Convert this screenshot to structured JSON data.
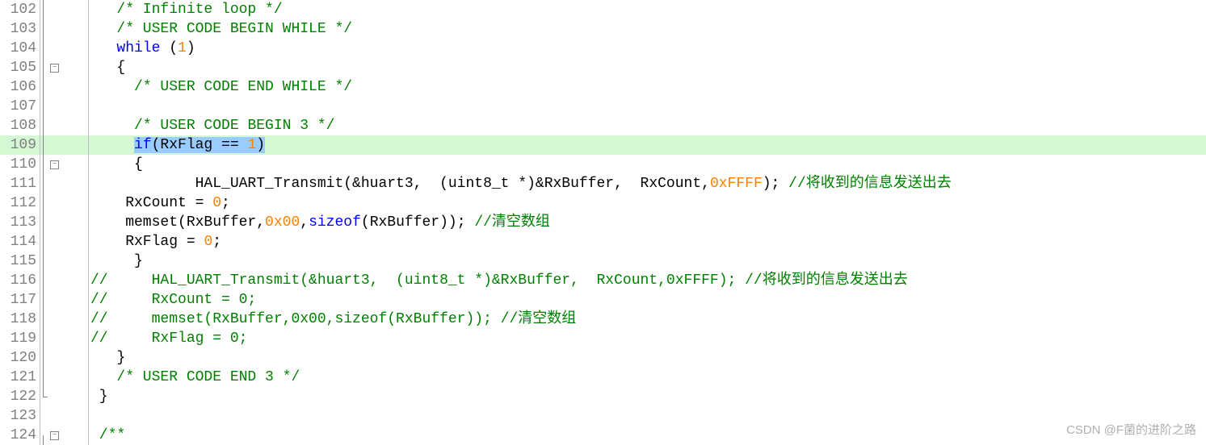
{
  "watermark": "CSDN @F菌的进阶之路",
  "lines": [
    {
      "n": 102,
      "fold": "line",
      "hl": false,
      "tokens": [
        [
          "plain",
          "   "
        ],
        [
          "comment",
          "/* Infinite loop */"
        ]
      ]
    },
    {
      "n": 103,
      "fold": "line",
      "hl": false,
      "tokens": [
        [
          "plain",
          "   "
        ],
        [
          "comment",
          "/* USER CODE BEGIN WHILE */"
        ]
      ]
    },
    {
      "n": 104,
      "fold": "line",
      "hl": false,
      "tokens": [
        [
          "plain",
          "   "
        ],
        [
          "keyword",
          "while"
        ],
        [
          "plain",
          " ("
        ],
        [
          "number",
          "1"
        ],
        [
          "plain",
          ")"
        ]
      ]
    },
    {
      "n": 105,
      "fold": "line-box",
      "hl": false,
      "tokens": [
        [
          "plain",
          "   {"
        ]
      ]
    },
    {
      "n": 106,
      "fold": "line",
      "hl": false,
      "tokens": [
        [
          "plain",
          "     "
        ],
        [
          "comment",
          "/* USER CODE END WHILE */"
        ]
      ]
    },
    {
      "n": 107,
      "fold": "line",
      "hl": false,
      "tokens": []
    },
    {
      "n": 108,
      "fold": "line",
      "hl": false,
      "tokens": [
        [
          "plain",
          "     "
        ],
        [
          "comment",
          "/* USER CODE BEGIN 3 */"
        ]
      ]
    },
    {
      "n": 109,
      "fold": "line",
      "hl": true,
      "tokens": [
        [
          "plain",
          "     "
        ],
        [
          "sel-keyword",
          "if"
        ],
        [
          "sel-plain",
          "(RxFlag == "
        ],
        [
          "sel-number",
          "1"
        ],
        [
          "sel-plain",
          ")"
        ]
      ]
    },
    {
      "n": 110,
      "fold": "line-box",
      "hl": false,
      "tokens": [
        [
          "plain",
          "     {"
        ]
      ]
    },
    {
      "n": 111,
      "fold": "line",
      "hl": false,
      "tokens": [
        [
          "plain",
          "            HAL_UART_Transmit(&huart3,  (uint8_t *)&RxBuffer,  RxCount,"
        ],
        [
          "number",
          "0xFFFF"
        ],
        [
          "plain",
          "); "
        ],
        [
          "comment",
          "//将收到的信息发送出去"
        ]
      ]
    },
    {
      "n": 112,
      "fold": "line",
      "hl": false,
      "tokens": [
        [
          "plain",
          "    RxCount = "
        ],
        [
          "number",
          "0"
        ],
        [
          "plain",
          ";"
        ]
      ]
    },
    {
      "n": 113,
      "fold": "line",
      "hl": false,
      "tokens": [
        [
          "plain",
          "    memset(RxBuffer,"
        ],
        [
          "number",
          "0x00"
        ],
        [
          "plain",
          ","
        ],
        [
          "keyword",
          "sizeof"
        ],
        [
          "plain",
          "(RxBuffer)); "
        ],
        [
          "comment",
          "//清空数组"
        ]
      ]
    },
    {
      "n": 114,
      "fold": "line",
      "hl": false,
      "tokens": [
        [
          "plain",
          "    RxFlag = "
        ],
        [
          "number",
          "0"
        ],
        [
          "plain",
          ";"
        ]
      ]
    },
    {
      "n": 115,
      "fold": "line",
      "hl": false,
      "tokens": [
        [
          "plain",
          "     }"
        ]
      ]
    },
    {
      "n": 116,
      "fold": "line",
      "hl": false,
      "tokens": [
        [
          "comment",
          "//     HAL_UART_Transmit(&huart3,  (uint8_t *)&RxBuffer,  RxCount,0xFFFF); //将收到的信息发送出去"
        ]
      ]
    },
    {
      "n": 117,
      "fold": "line",
      "hl": false,
      "tokens": [
        [
          "comment",
          "//     RxCount = 0;"
        ]
      ]
    },
    {
      "n": 118,
      "fold": "line",
      "hl": false,
      "tokens": [
        [
          "comment",
          "//     memset(RxBuffer,0x00,sizeof(RxBuffer)); //清空数组"
        ]
      ]
    },
    {
      "n": 119,
      "fold": "line",
      "hl": false,
      "tokens": [
        [
          "comment",
          "//     RxFlag = 0;"
        ]
      ]
    },
    {
      "n": 120,
      "fold": "line",
      "hl": false,
      "tokens": [
        [
          "plain",
          "   }"
        ]
      ]
    },
    {
      "n": 121,
      "fold": "line",
      "hl": false,
      "tokens": [
        [
          "plain",
          "   "
        ],
        [
          "comment",
          "/* USER CODE END 3 */"
        ]
      ]
    },
    {
      "n": 122,
      "fold": "corner",
      "hl": false,
      "tokens": [
        [
          "plain",
          " }"
        ]
      ]
    },
    {
      "n": 123,
      "fold": "none",
      "hl": false,
      "tokens": []
    },
    {
      "n": 124,
      "fold": "box-start",
      "hl": false,
      "tokens": [
        [
          "comment",
          " /**"
        ]
      ]
    }
  ]
}
